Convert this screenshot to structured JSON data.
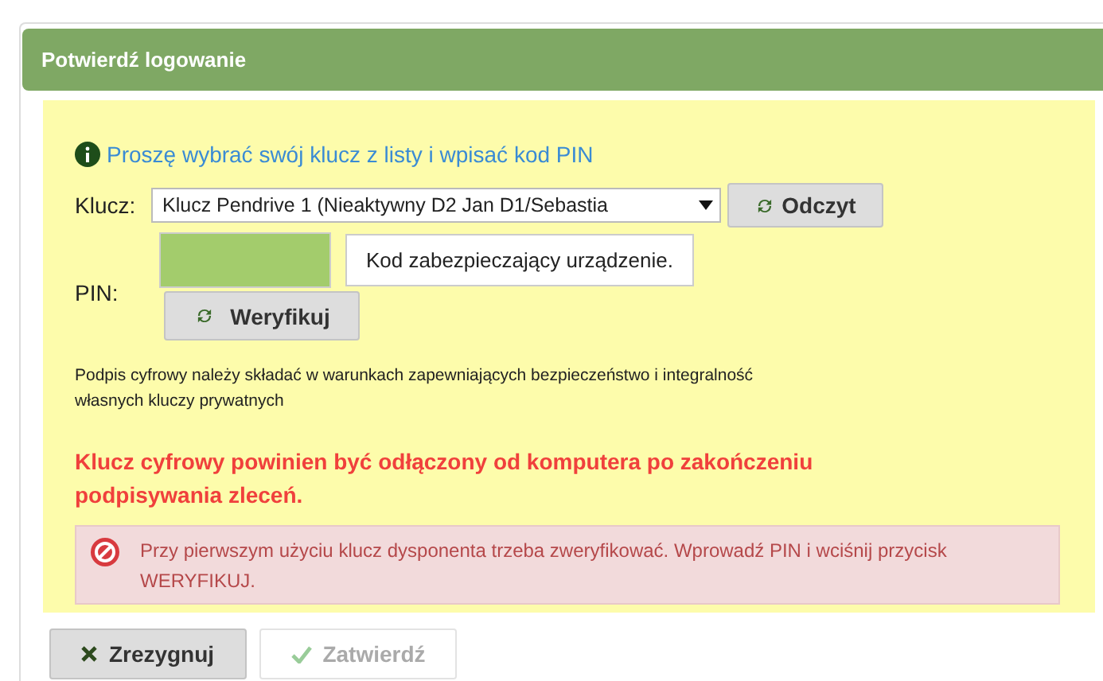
{
  "window": {
    "title": "Potwierdź logowanie"
  },
  "info": "Proszę wybrać swój klucz z listy i wpisać kod PIN",
  "key_field": {
    "label": "Klucz:",
    "value": "Klucz Pendrive 1 (Nieaktywny D2 Jan D1/Sebastia"
  },
  "read_button": {
    "label": "Odczyt"
  },
  "pin_field": {
    "label": "PIN:",
    "tooltip": "Kod zabezpieczający urządzenie."
  },
  "verify_button": {
    "label": "Weryfikuj"
  },
  "note": "Podpis cyfrowy należy składać w warunkach zapewniających bezpieczeństwo i integralność własnych kluczy prywatnych",
  "warning": "Klucz cyfrowy powinien być odłączony od komputera po zakończeniu podpisywania zleceń.",
  "error": "Przy pierwszym użyciu klucz dysponenta trzeba zweryfikować. Wprowadź PIN i wciśnij przycisk WERYFIKUJ.",
  "buttons": [
    {
      "label": "Zrezygnuj",
      "kind": "cancel",
      "disabled": false
    },
    {
      "label": "Zatwierdź",
      "kind": "confirm",
      "disabled": true
    }
  ]
}
